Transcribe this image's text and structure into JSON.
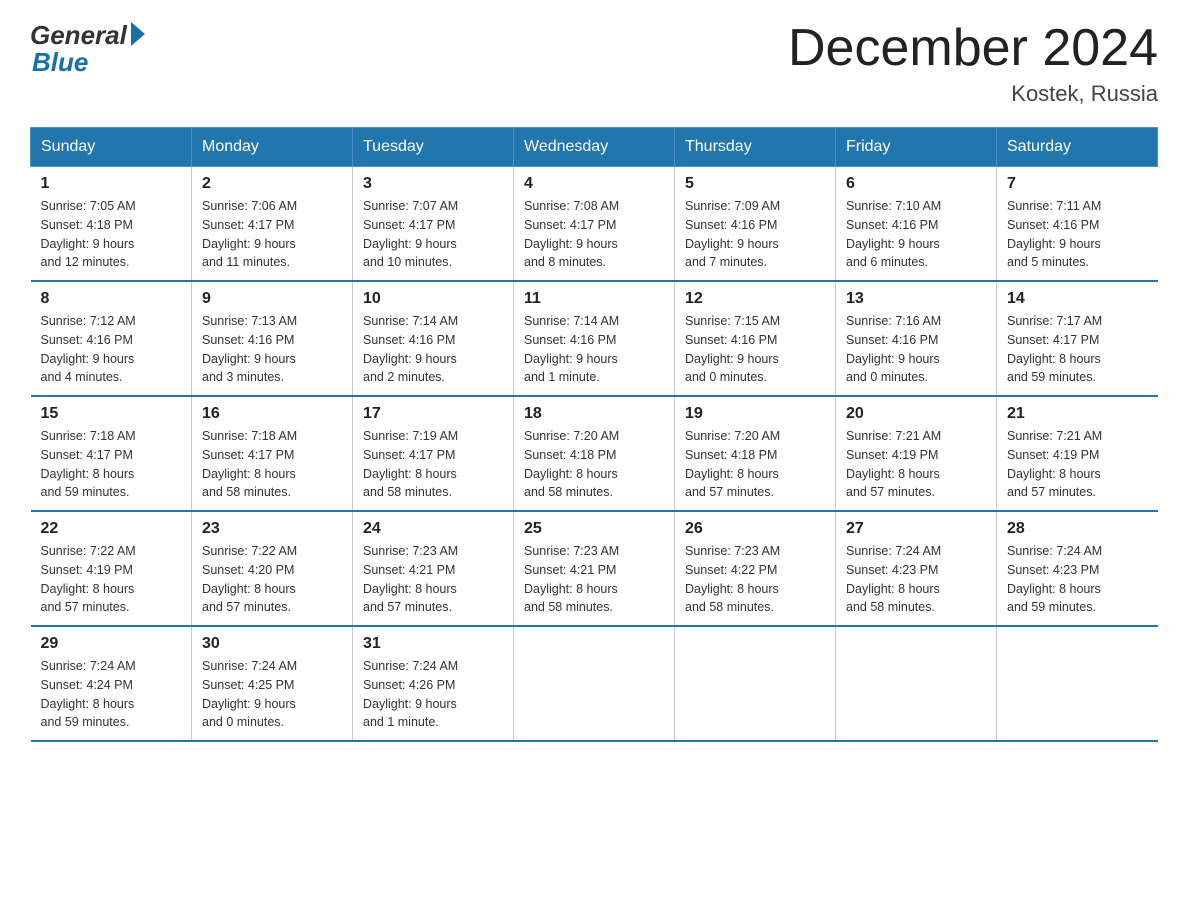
{
  "logo": {
    "general_text": "General",
    "blue_text": "Blue"
  },
  "header": {
    "title": "December 2024",
    "subtitle": "Kostek, Russia"
  },
  "weekdays": [
    "Sunday",
    "Monday",
    "Tuesday",
    "Wednesday",
    "Thursday",
    "Friday",
    "Saturday"
  ],
  "weeks": [
    [
      {
        "day": "1",
        "sunrise": "7:05 AM",
        "sunset": "4:18 PM",
        "daylight": "9 hours and 12 minutes."
      },
      {
        "day": "2",
        "sunrise": "7:06 AM",
        "sunset": "4:17 PM",
        "daylight": "9 hours and 11 minutes."
      },
      {
        "day": "3",
        "sunrise": "7:07 AM",
        "sunset": "4:17 PM",
        "daylight": "9 hours and 10 minutes."
      },
      {
        "day": "4",
        "sunrise": "7:08 AM",
        "sunset": "4:17 PM",
        "daylight": "9 hours and 8 minutes."
      },
      {
        "day": "5",
        "sunrise": "7:09 AM",
        "sunset": "4:16 PM",
        "daylight": "9 hours and 7 minutes."
      },
      {
        "day": "6",
        "sunrise": "7:10 AM",
        "sunset": "4:16 PM",
        "daylight": "9 hours and 6 minutes."
      },
      {
        "day": "7",
        "sunrise": "7:11 AM",
        "sunset": "4:16 PM",
        "daylight": "9 hours and 5 minutes."
      }
    ],
    [
      {
        "day": "8",
        "sunrise": "7:12 AM",
        "sunset": "4:16 PM",
        "daylight": "9 hours and 4 minutes."
      },
      {
        "day": "9",
        "sunrise": "7:13 AM",
        "sunset": "4:16 PM",
        "daylight": "9 hours and 3 minutes."
      },
      {
        "day": "10",
        "sunrise": "7:14 AM",
        "sunset": "4:16 PM",
        "daylight": "9 hours and 2 minutes."
      },
      {
        "day": "11",
        "sunrise": "7:14 AM",
        "sunset": "4:16 PM",
        "daylight": "9 hours and 1 minute."
      },
      {
        "day": "12",
        "sunrise": "7:15 AM",
        "sunset": "4:16 PM",
        "daylight": "9 hours and 0 minutes."
      },
      {
        "day": "13",
        "sunrise": "7:16 AM",
        "sunset": "4:16 PM",
        "daylight": "9 hours and 0 minutes."
      },
      {
        "day": "14",
        "sunrise": "7:17 AM",
        "sunset": "4:17 PM",
        "daylight": "8 hours and 59 minutes."
      }
    ],
    [
      {
        "day": "15",
        "sunrise": "7:18 AM",
        "sunset": "4:17 PM",
        "daylight": "8 hours and 59 minutes."
      },
      {
        "day": "16",
        "sunrise": "7:18 AM",
        "sunset": "4:17 PM",
        "daylight": "8 hours and 58 minutes."
      },
      {
        "day": "17",
        "sunrise": "7:19 AM",
        "sunset": "4:17 PM",
        "daylight": "8 hours and 58 minutes."
      },
      {
        "day": "18",
        "sunrise": "7:20 AM",
        "sunset": "4:18 PM",
        "daylight": "8 hours and 58 minutes."
      },
      {
        "day": "19",
        "sunrise": "7:20 AM",
        "sunset": "4:18 PM",
        "daylight": "8 hours and 57 minutes."
      },
      {
        "day": "20",
        "sunrise": "7:21 AM",
        "sunset": "4:19 PM",
        "daylight": "8 hours and 57 minutes."
      },
      {
        "day": "21",
        "sunrise": "7:21 AM",
        "sunset": "4:19 PM",
        "daylight": "8 hours and 57 minutes."
      }
    ],
    [
      {
        "day": "22",
        "sunrise": "7:22 AM",
        "sunset": "4:19 PM",
        "daylight": "8 hours and 57 minutes."
      },
      {
        "day": "23",
        "sunrise": "7:22 AM",
        "sunset": "4:20 PM",
        "daylight": "8 hours and 57 minutes."
      },
      {
        "day": "24",
        "sunrise": "7:23 AM",
        "sunset": "4:21 PM",
        "daylight": "8 hours and 57 minutes."
      },
      {
        "day": "25",
        "sunrise": "7:23 AM",
        "sunset": "4:21 PM",
        "daylight": "8 hours and 58 minutes."
      },
      {
        "day": "26",
        "sunrise": "7:23 AM",
        "sunset": "4:22 PM",
        "daylight": "8 hours and 58 minutes."
      },
      {
        "day": "27",
        "sunrise": "7:24 AM",
        "sunset": "4:23 PM",
        "daylight": "8 hours and 58 minutes."
      },
      {
        "day": "28",
        "sunrise": "7:24 AM",
        "sunset": "4:23 PM",
        "daylight": "8 hours and 59 minutes."
      }
    ],
    [
      {
        "day": "29",
        "sunrise": "7:24 AM",
        "sunset": "4:24 PM",
        "daylight": "8 hours and 59 minutes."
      },
      {
        "day": "30",
        "sunrise": "7:24 AM",
        "sunset": "4:25 PM",
        "daylight": "9 hours and 0 minutes."
      },
      {
        "day": "31",
        "sunrise": "7:24 AM",
        "sunset": "4:26 PM",
        "daylight": "9 hours and 1 minute."
      },
      null,
      null,
      null,
      null
    ]
  ],
  "labels": {
    "sunrise": "Sunrise:",
    "sunset": "Sunset:",
    "daylight": "Daylight:"
  }
}
